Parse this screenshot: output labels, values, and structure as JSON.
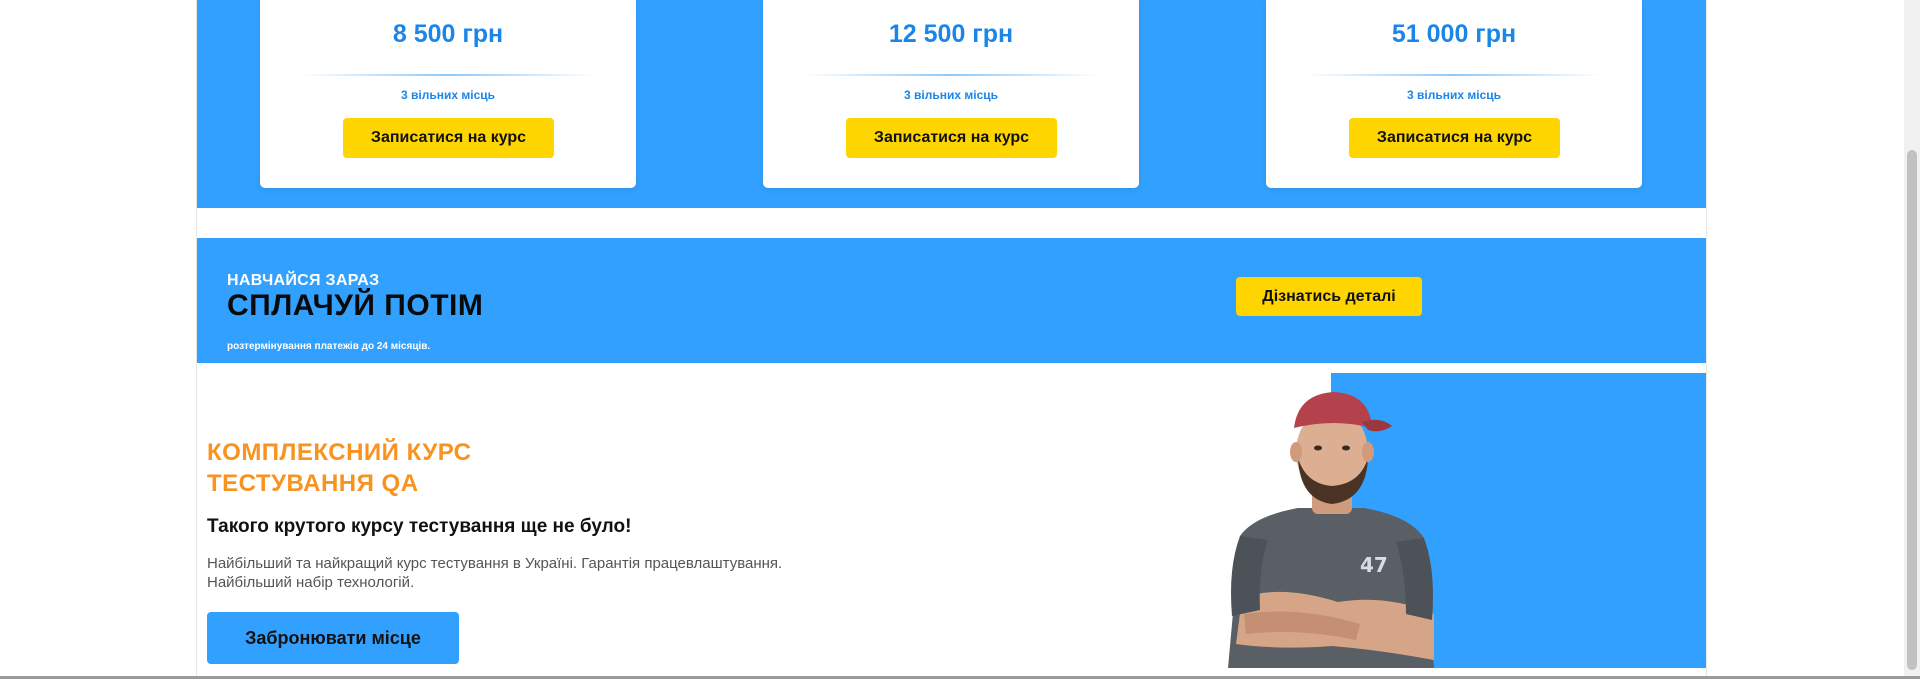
{
  "pricing": {
    "cards": [
      {
        "price": "8 500 грн",
        "seats": "3 вільних місць",
        "button": "Записатися на курс"
      },
      {
        "price": "12 500 грн",
        "seats": "3 вільних місць",
        "button": "Записатися на курс"
      },
      {
        "price": "51 000 грн",
        "seats": "3 вільних місць",
        "button": "Записатися на курс"
      }
    ]
  },
  "payment_banner": {
    "small_heading": "НАВЧАЙСЯ ЗАРАЗ",
    "big_heading": "СПЛАЧУЙ ПОТІМ",
    "note": "розтермінування платежів до 24 місяців.",
    "button": "Дізнатись деталі"
  },
  "course": {
    "title_lines": [
      "КОМПЛЕКСНИЙ КУРС",
      "ТЕСТУВАННЯ QA"
    ],
    "tagline": "Такого крутого курсу тестування ще не було!",
    "description_lines": [
      "Найбільший та найкращий курс тестування в Україні. Гарантія працевлаштування.",
      "Найбільший набір технологій."
    ],
    "button": "Забронювати місце",
    "instructor_shirt_text": "47"
  },
  "colors": {
    "brand_blue": "#32a0fe",
    "price_blue": "#1b86e8",
    "cta_yellow": "#ffd500",
    "title_orange": "#f7931e"
  }
}
